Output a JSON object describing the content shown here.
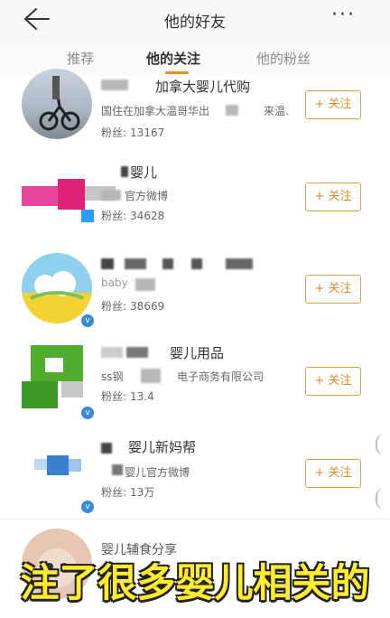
{
  "header": {
    "title": "他的好友",
    "back_icon": "back-arrow-icon",
    "more_label": "···"
  },
  "tabs": [
    {
      "label": "推荐",
      "active": false
    },
    {
      "label": "他的关注",
      "active": true
    },
    {
      "label": "他的粉丝",
      "active": false
    }
  ],
  "accent_color": "#f28c1d",
  "follow_label": "+ 关注",
  "rows": [
    {
      "name": "加拿大婴儿代购",
      "desc": "国住在加拿大温哥华出",
      "desc2": "来温.",
      "fans_label": "粉丝:",
      "fans": "13167"
    },
    {
      "name": "婴儿",
      "desc": "官方微博",
      "fans_label": "粉丝:",
      "fans": "34628"
    },
    {
      "name": "",
      "desc": "baby",
      "fans_label": "粉丝:",
      "fans": "38669"
    },
    {
      "name": "婴儿用品",
      "desc": "ss钢",
      "desc2": "电子商务有限公司",
      "fans_label": "粉丝:",
      "fans": "13.4"
    },
    {
      "name": "婴儿新妈帮",
      "desc": "婴儿官方微博",
      "fans_label": "粉丝:",
      "fans": "13万"
    }
  ],
  "partial_row": {
    "name": "婴儿辅食分享"
  },
  "caption": "注了很多婴儿相关的"
}
